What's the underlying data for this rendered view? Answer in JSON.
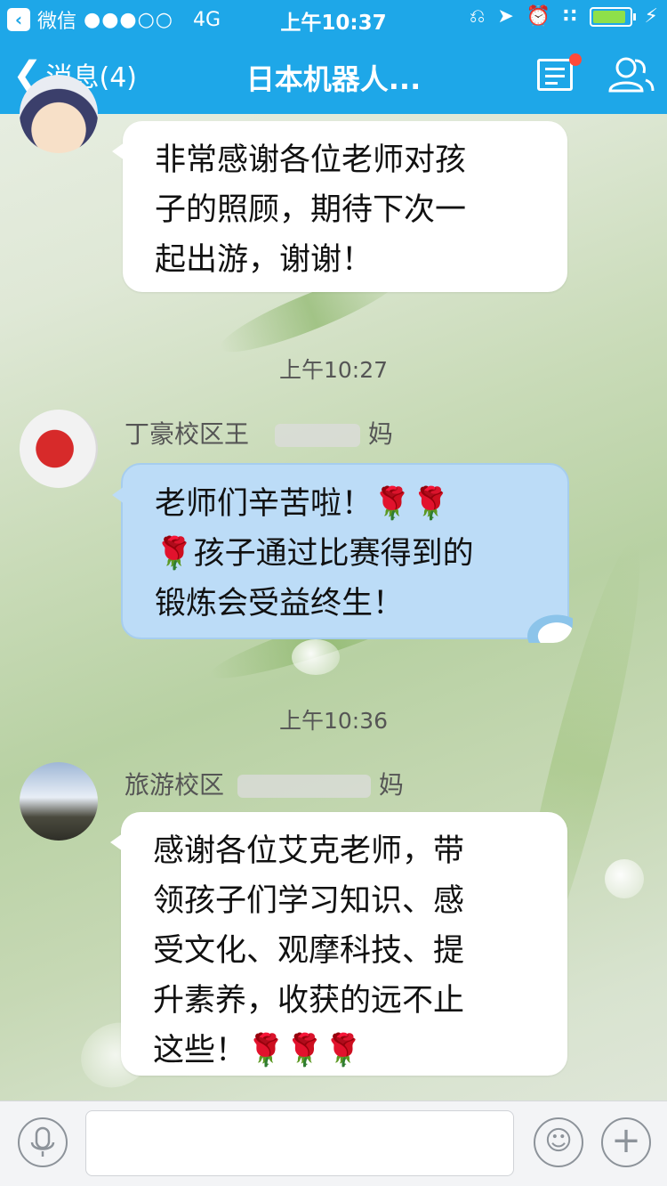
{
  "status_bar": {
    "back_app": "微信",
    "carrier_signal": "●●●○○",
    "network": "4G",
    "time": "上午10:37"
  },
  "nav": {
    "back_label": "消息(4)",
    "title": "日本机器人..."
  },
  "messages": [
    {
      "type": "message",
      "sender": "",
      "text_lines": [
        "非常感谢各位老师对孩",
        "子的照顾，期待下次一",
        "起出游，谢谢！"
      ],
      "style": "white"
    },
    {
      "type": "timestamp",
      "text": "上午10:27"
    },
    {
      "type": "message",
      "sender_prefix": "丁豪校区王",
      "sender_suffix": "妈",
      "text_lines": [
        "老师们辛苦啦！🌹🌹",
        "🌹孩子通过比赛得到的",
        "锻炼会受益终生！"
      ],
      "style": "blue"
    },
    {
      "type": "timestamp",
      "text": "上午10:36"
    },
    {
      "type": "message",
      "sender_prefix": "旅游校区",
      "sender_suffix": "妈",
      "text_lines": [
        "感谢各位艾克老师，带",
        "领孩子们学习知识、感",
        "受文化、观摩科技、提",
        "升素养，收获的远不止",
        "这些！🌹🌹🌹"
      ],
      "style": "white"
    }
  ],
  "input_bar": {
    "placeholder": ""
  },
  "colors": {
    "header": "#1ea7e8",
    "bubble_white": "#ffffff",
    "bubble_blue": "#bcdcf7",
    "notification_dot": "#ff4a3a"
  }
}
